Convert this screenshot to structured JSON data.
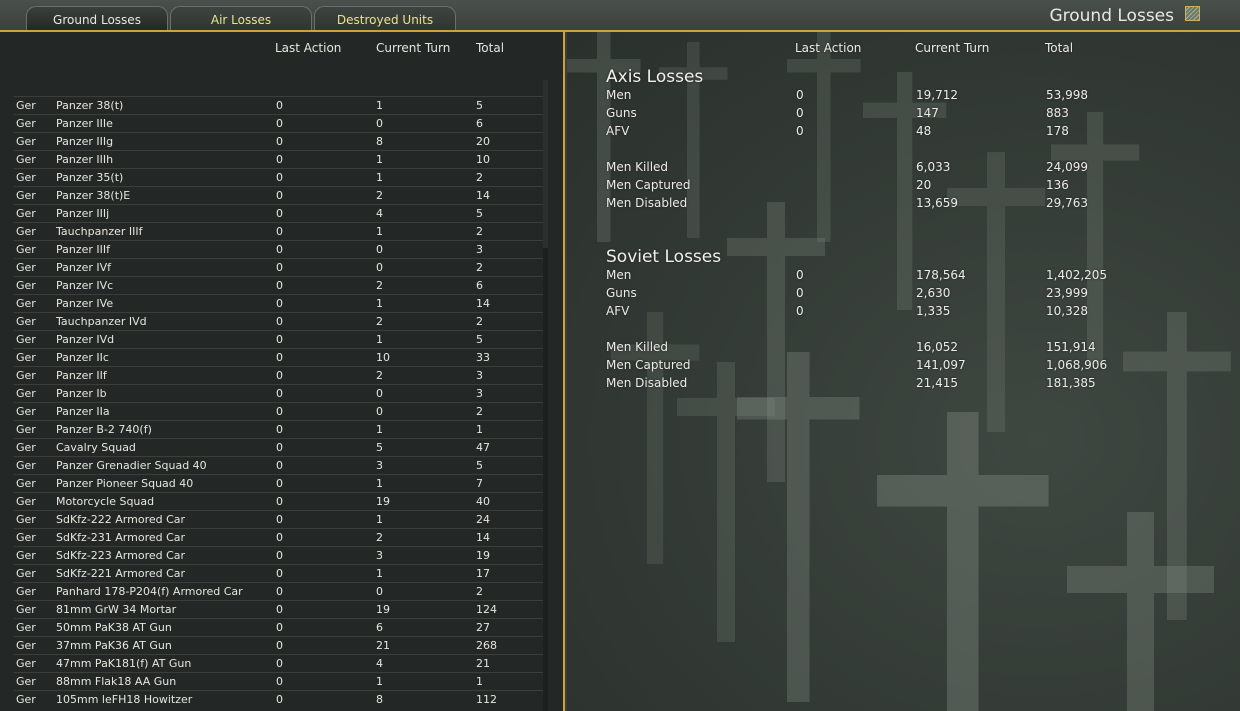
{
  "tabs": [
    {
      "label": "Ground Losses",
      "active": true
    },
    {
      "label": "Air Losses",
      "active": false
    },
    {
      "label": "Destroyed Units",
      "active": false
    }
  ],
  "window_title": "Ground Losses",
  "columns": {
    "last_action": "Last Action",
    "current_turn": "Current Turn",
    "total": "Total"
  },
  "units": [
    [
      "Ger",
      "Panzer 38(t)",
      "0",
      "1",
      "5"
    ],
    [
      "Ger",
      "Panzer IIIe",
      "0",
      "0",
      "6"
    ],
    [
      "Ger",
      "Panzer IIIg",
      "0",
      "8",
      "20"
    ],
    [
      "Ger",
      "Panzer IIIh",
      "0",
      "1",
      "10"
    ],
    [
      "Ger",
      "Panzer 35(t)",
      "0",
      "1",
      "2"
    ],
    [
      "Ger",
      "Panzer 38(t)E",
      "0",
      "2",
      "14"
    ],
    [
      "Ger",
      "Panzer IIIj",
      "0",
      "4",
      "5"
    ],
    [
      "Ger",
      "Tauchpanzer IIIf",
      "0",
      "1",
      "2"
    ],
    [
      "Ger",
      "Panzer IIIf",
      "0",
      "0",
      "3"
    ],
    [
      "Ger",
      "Panzer IVf",
      "0",
      "0",
      "2"
    ],
    [
      "Ger",
      "Panzer IVc",
      "0",
      "2",
      "6"
    ],
    [
      "Ger",
      "Panzer IVe",
      "0",
      "1",
      "14"
    ],
    [
      "Ger",
      "Tauchpanzer IVd",
      "0",
      "2",
      "2"
    ],
    [
      "Ger",
      "Panzer IVd",
      "0",
      "1",
      "5"
    ],
    [
      "Ger",
      "Panzer IIc",
      "0",
      "10",
      "33"
    ],
    [
      "Ger",
      "Panzer IIf",
      "0",
      "2",
      "3"
    ],
    [
      "Ger",
      "Panzer Ib",
      "0",
      "0",
      "3"
    ],
    [
      "Ger",
      "Panzer IIa",
      "0",
      "0",
      "2"
    ],
    [
      "Ger",
      "Panzer B-2 740(f)",
      "0",
      "1",
      "1"
    ],
    [
      "Ger",
      "Cavalry Squad",
      "0",
      "5",
      "47"
    ],
    [
      "Ger",
      "Panzer Grenadier Squad 40",
      "0",
      "3",
      "5"
    ],
    [
      "Ger",
      "Panzer Pioneer Squad 40",
      "0",
      "1",
      "7"
    ],
    [
      "Ger",
      "Motorcycle Squad",
      "0",
      "19",
      "40"
    ],
    [
      "Ger",
      "SdKfz-222 Armored Car",
      "0",
      "1",
      "24"
    ],
    [
      "Ger",
      "SdKfz-231 Armored Car",
      "0",
      "2",
      "14"
    ],
    [
      "Ger",
      "SdKfz-223 Armored Car",
      "0",
      "3",
      "19"
    ],
    [
      "Ger",
      "SdKfz-221 Armored Car",
      "0",
      "1",
      "17"
    ],
    [
      "Ger",
      "Panhard 178-P204(f) Armored Car",
      "0",
      "0",
      "2"
    ],
    [
      "Ger",
      "81mm GrW 34 Mortar",
      "0",
      "19",
      "124"
    ],
    [
      "Ger",
      "50mm PaK38 AT Gun",
      "0",
      "6",
      "27"
    ],
    [
      "Ger",
      "37mm PaK36 AT Gun",
      "0",
      "21",
      "268"
    ],
    [
      "Ger",
      "47mm PaK181(f) AT Gun",
      "0",
      "4",
      "21"
    ],
    [
      "Ger",
      "88mm Flak18 AA Gun",
      "0",
      "1",
      "1"
    ],
    [
      "Ger",
      "105mm leFH18 Howitzer",
      "0",
      "8",
      "112"
    ]
  ],
  "summary": [
    {
      "title": "Axis Losses",
      "rows": [
        [
          "Men",
          "0",
          "19,712",
          "53,998"
        ],
        [
          "Guns",
          "0",
          "147",
          "883"
        ],
        [
          "AFV",
          "0",
          "48",
          "178"
        ]
      ],
      "detail": [
        [
          "Men Killed",
          "6,033",
          "24,099"
        ],
        [
          "Men Captured",
          "20",
          "136"
        ],
        [
          "Men Disabled",
          "13,659",
          "29,763"
        ]
      ]
    },
    {
      "title": "Soviet Losses",
      "rows": [
        [
          "Men",
          "0",
          "178,564",
          "1,402,205"
        ],
        [
          "Guns",
          "0",
          "2,630",
          "23,999"
        ],
        [
          "AFV",
          "0",
          "1,335",
          "10,328"
        ]
      ],
      "detail": [
        [
          "Men Killed",
          "16,052",
          "151,914"
        ],
        [
          "Men Captured",
          "141,097",
          "1,068,906"
        ],
        [
          "Men Disabled",
          "21,415",
          "181,385"
        ]
      ]
    }
  ]
}
